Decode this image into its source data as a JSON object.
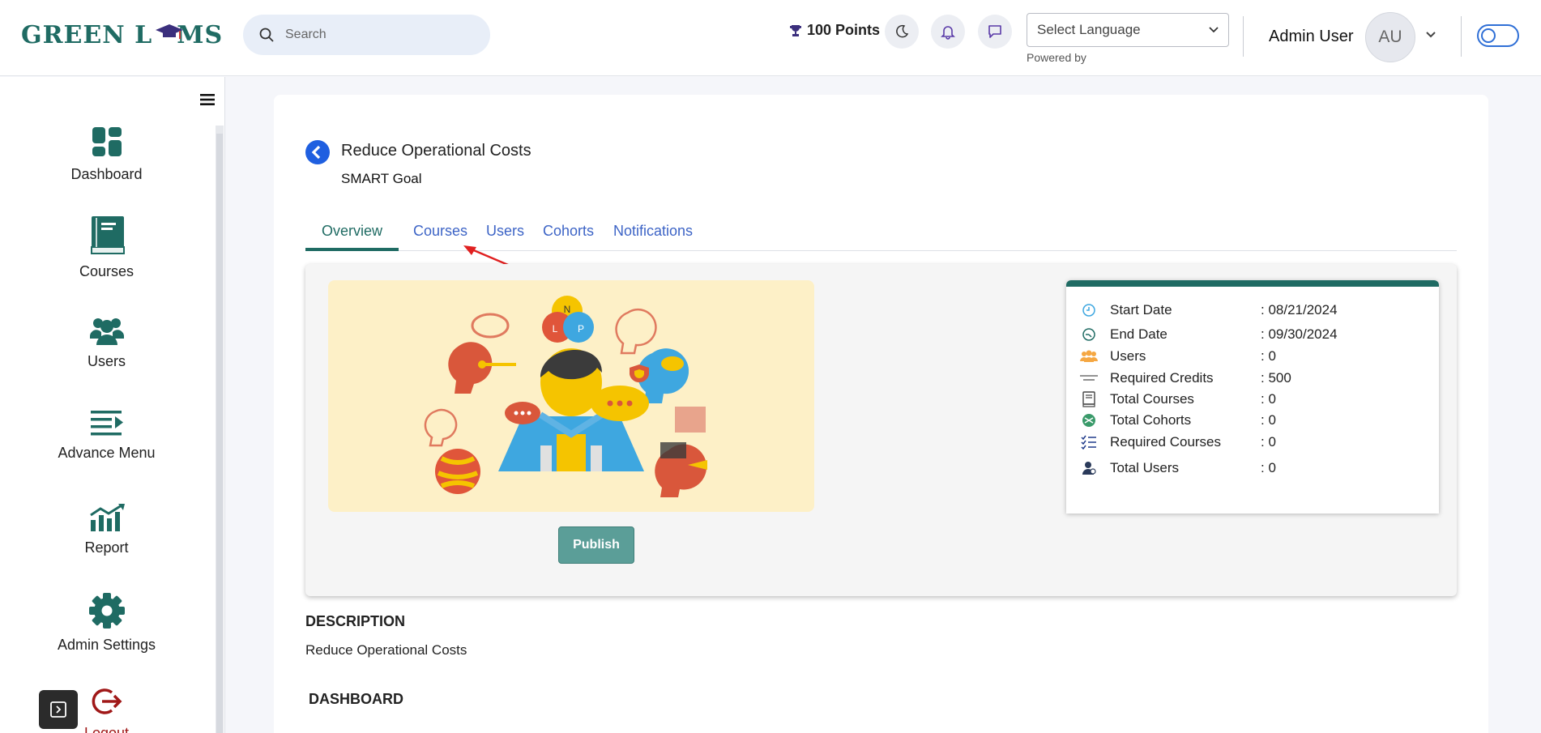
{
  "header": {
    "logo_left": "GREEN L",
    "logo_right": "MS",
    "search_placeholder": "Search",
    "points": "100 Points",
    "language_select": "Select Language",
    "powered_by": "Powered by",
    "user_name": "Admin User",
    "avatar_initials": "AU"
  },
  "sidebar": {
    "items": [
      {
        "label": "Dashboard",
        "icon": "dashboard-icon"
      },
      {
        "label": "Courses",
        "icon": "book-icon"
      },
      {
        "label": "Users",
        "icon": "users-icon"
      },
      {
        "label": "Advance Menu",
        "icon": "menu-arrow-icon"
      },
      {
        "label": "Report",
        "icon": "report-chart-icon"
      },
      {
        "label": "Admin Settings",
        "icon": "gear-icon"
      },
      {
        "label": "Logout",
        "icon": "logout-icon"
      }
    ]
  },
  "goal": {
    "title": "Reduce Operational Costs",
    "subtitle": "SMART Goal"
  },
  "tabs": [
    "Overview",
    "Courses",
    "Users",
    "Cohorts",
    "Notifications"
  ],
  "active_tab": "Overview",
  "hero_letters": [
    "N",
    "L",
    "P"
  ],
  "publish_label": "Publish",
  "stats": [
    {
      "label": "Start Date",
      "value": ": 08/21/2024",
      "icon": "clock-icon"
    },
    {
      "label": "End Date",
      "value": ": 09/30/2024",
      "icon": "clock-end-icon"
    },
    {
      "label": "Users",
      "value": ": 0",
      "icon": "users-icon"
    },
    {
      "label": "Required Credits",
      "value": ": 500",
      "icon": "credits-icon"
    },
    {
      "label": "Total Courses",
      "value": ": 0",
      "icon": "courses-icon"
    },
    {
      "label": "Total Cohorts",
      "value": ": 0",
      "icon": "cohorts-icon"
    },
    {
      "label": "Required Courses",
      "value": ": 0",
      "icon": "checklist-icon"
    },
    {
      "label": "Total Users",
      "value": ": 0",
      "icon": "user-icon"
    }
  ],
  "description": {
    "heading": "DESCRIPTION",
    "text": "Reduce Operational Costs"
  },
  "dashboard_heading": "DASHBOARD",
  "colors": {
    "brand": "#1f6b63",
    "tab_link": "#3d64c6",
    "publish": "#5b9e98",
    "logout": "#a01818"
  }
}
